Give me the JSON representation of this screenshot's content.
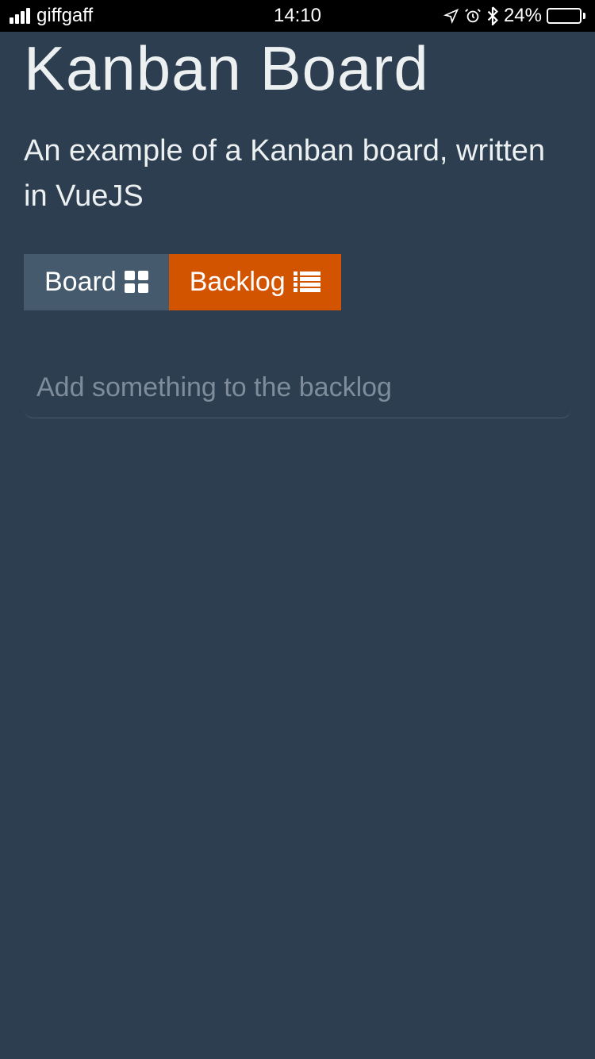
{
  "status_bar": {
    "carrier": "giffgaff",
    "time": "14:10",
    "battery_percent": "24%",
    "icons": {
      "location": "location-arrow-icon",
      "alarm": "alarm-clock-icon",
      "bluetooth": "bluetooth-icon"
    }
  },
  "header": {
    "title": "Kanban Board",
    "subtitle": "An example of a Kanban board, written in VueJS"
  },
  "tabs": {
    "board": {
      "label": "Board",
      "active": false
    },
    "backlog": {
      "label": "Backlog",
      "active": true
    }
  },
  "input": {
    "placeholder": "Add something to the backlog",
    "value": ""
  },
  "colors": {
    "background": "#2C3E50",
    "accent": "#D35400",
    "tab_inactive": "#465a6e",
    "text": "#ECF0F1"
  }
}
